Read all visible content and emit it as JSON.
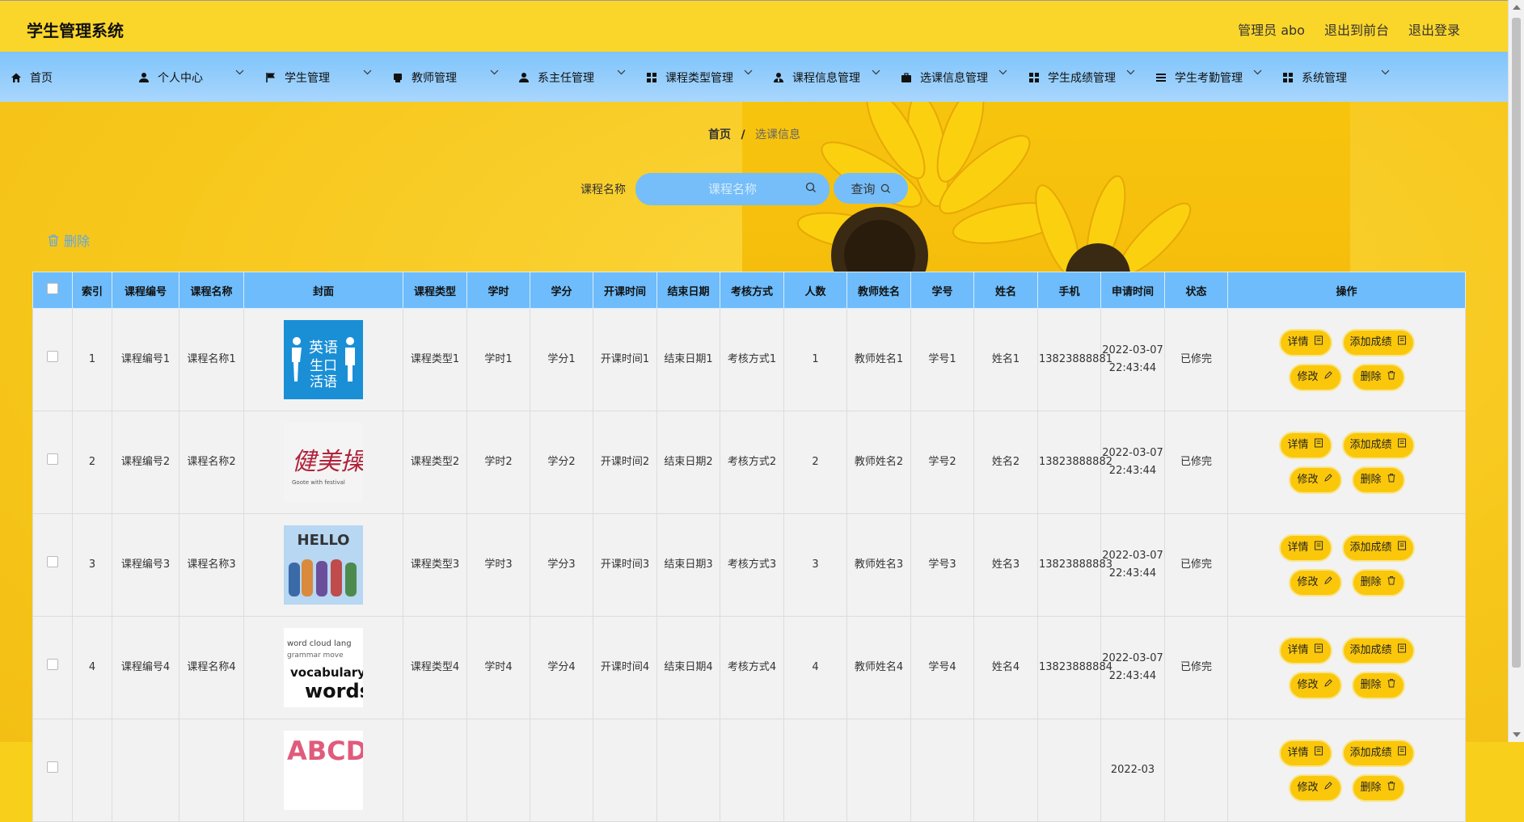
{
  "app": {
    "title": "学生管理系统"
  },
  "top_links": {
    "user": "管理员 abo",
    "front": "退出到前台",
    "logout": "退出登录"
  },
  "nav": [
    {
      "label": "首页",
      "icon": "home-icon"
    },
    {
      "label": "个人中心",
      "icon": "user-icon"
    },
    {
      "label": "学生管理",
      "icon": "flag-icon"
    },
    {
      "label": "教师管理",
      "icon": "printer-icon"
    },
    {
      "label": "系主任管理",
      "icon": "user-icon"
    },
    {
      "label": "课程类型管理",
      "icon": "grid-icon"
    },
    {
      "label": "课程信息管理",
      "icon": "user-tie-icon"
    },
    {
      "label": "选课信息管理",
      "icon": "briefcase-icon"
    },
    {
      "label": "学生成绩管理",
      "icon": "grid-icon"
    },
    {
      "label": "学生考勤管理",
      "icon": "list-icon"
    },
    {
      "label": "系统管理",
      "icon": "grid-icon"
    }
  ],
  "breadcrumb": {
    "home": "首页",
    "sep": "/",
    "current": "选课信息"
  },
  "search": {
    "label": "课程名称",
    "placeholder": "课程名称",
    "button": "查询"
  },
  "bulk": {
    "delete": "删除"
  },
  "table": {
    "columns": [
      "",
      "索引",
      "课程编号",
      "课程名称",
      "封面",
      "课程类型",
      "学时",
      "学分",
      "开课时间",
      "结束日期",
      "考核方式",
      "人数",
      "教师姓名",
      "学号",
      "姓名",
      "手机",
      "申请时间",
      "状态",
      "操作"
    ],
    "rows": [
      {
        "idx": "1",
        "code": "课程编号1",
        "name": "课程名称1",
        "cover": "english-speaking-cover",
        "type": "课程类型1",
        "hours": "学时1",
        "credit": "学分1",
        "start": "开课时间1",
        "end": "结束日期1",
        "exam": "考核方式1",
        "count": "1",
        "teacher": "教师姓名1",
        "sno": "学号1",
        "sname": "姓名1",
        "phone": "13823888881",
        "applied": "2022-03-07 22:43:44",
        "status": "已修完"
      },
      {
        "idx": "2",
        "code": "课程编号2",
        "name": "课程名称2",
        "cover": "aerobics-cover",
        "type": "课程类型2",
        "hours": "学时2",
        "credit": "学分2",
        "start": "开课时间2",
        "end": "结束日期2",
        "exam": "考核方式2",
        "count": "2",
        "teacher": "教师姓名2",
        "sno": "学号2",
        "sname": "姓名2",
        "phone": "13823888882",
        "applied": "2022-03-07 22:43:44",
        "status": "已修完"
      },
      {
        "idx": "3",
        "code": "课程编号3",
        "name": "课程名称3",
        "cover": "hello-kids-cover",
        "type": "课程类型3",
        "hours": "学时3",
        "credit": "学分3",
        "start": "开课时间3",
        "end": "结束日期3",
        "exam": "考核方式3",
        "count": "3",
        "teacher": "教师姓名3",
        "sno": "学号3",
        "sname": "姓名3",
        "phone": "13823888883",
        "applied": "2022-03-07 22:43:44",
        "status": "已修完"
      },
      {
        "idx": "4",
        "code": "课程编号4",
        "name": "课程名称4",
        "cover": "vocabulary-words-cover",
        "type": "课程类型4",
        "hours": "学时4",
        "credit": "学分4",
        "start": "开课时间4",
        "end": "结束日期4",
        "exam": "考核方式4",
        "count": "4",
        "teacher": "教师姓名4",
        "sno": "学号4",
        "sname": "姓名4",
        "phone": "13823888884",
        "applied": "2022-03-07 22:43:44",
        "status": "已修完"
      },
      {
        "idx": "",
        "code": "",
        "name": "",
        "cover": "abcd-cover",
        "type": "",
        "hours": "",
        "credit": "",
        "start": "",
        "end": "",
        "exam": "",
        "count": "",
        "teacher": "",
        "sno": "",
        "sname": "",
        "phone": "",
        "applied": "2022-03",
        "status": ""
      }
    ],
    "actions": {
      "detail": "详情",
      "add_score": "添加成绩",
      "edit": "修改",
      "delete": "删除"
    }
  },
  "cover_text": {
    "english": [
      "英语",
      "生口",
      "活语"
    ],
    "aerobics": [
      "健美操"
    ],
    "aerobics_caption": "Goote with festival",
    "hello": "HELLO",
    "vocab": [
      "vocabulary",
      "words"
    ],
    "abcd": "ABCD"
  },
  "colors": {
    "topbar": "#fbd62a",
    "nav": "#8ccbfb",
    "accent": "#75bef9",
    "button": "#fbc70a",
    "header_cell": "#6ebcfb"
  }
}
